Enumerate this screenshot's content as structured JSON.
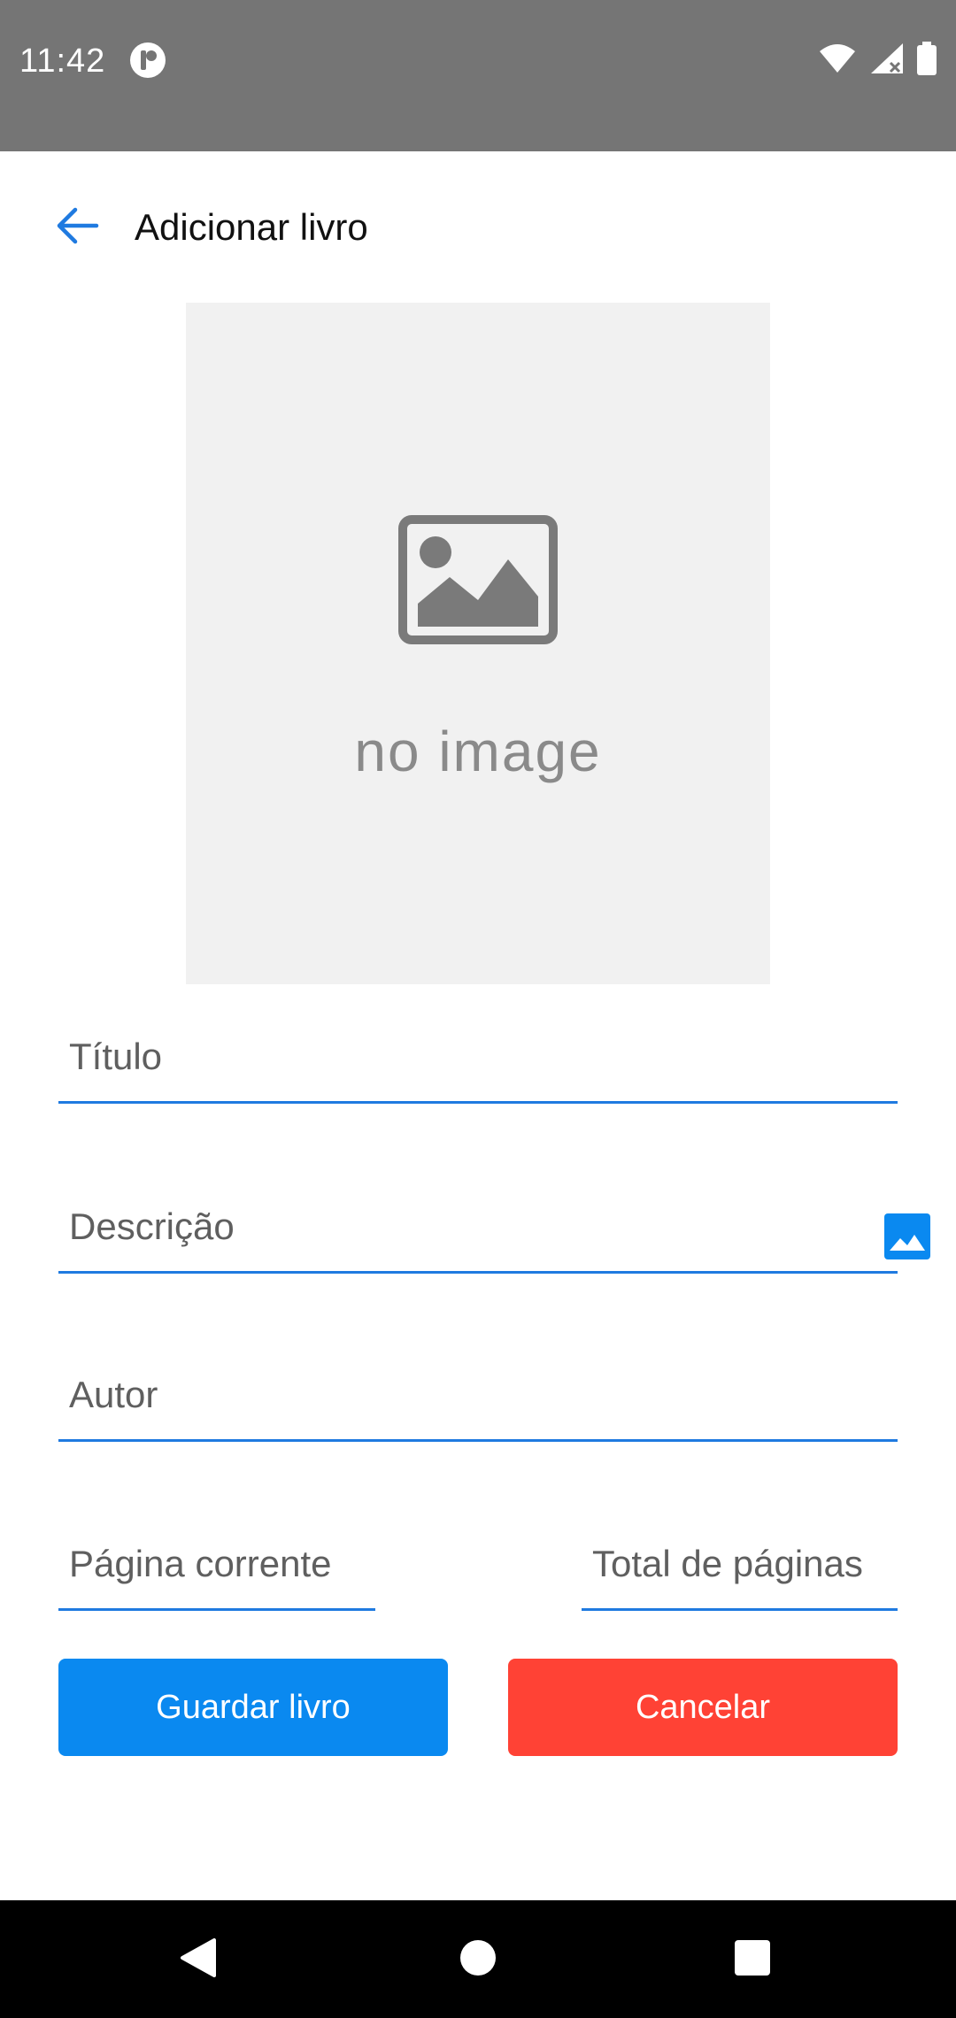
{
  "status_bar": {
    "time": "11:42",
    "icons": [
      "app-notification-icon",
      "wifi-icon",
      "signal-icon",
      "battery-icon"
    ]
  },
  "app_bar": {
    "title": "Adicionar livro",
    "back_icon": "arrow-back-icon"
  },
  "cover": {
    "placeholder_text": "no image",
    "pick_icon": "image-icon"
  },
  "form": {
    "titulo_placeholder": "Título",
    "titulo_value": "",
    "descricao_placeholder": "Descrição",
    "descricao_value": "",
    "autor_placeholder": "Autor",
    "autor_value": "",
    "pagina_corrente_placeholder": "Página corrente",
    "pagina_corrente_value": "",
    "total_paginas_placeholder": "Total de páginas",
    "total_paginas_value": ""
  },
  "buttons": {
    "save_label": "Guardar livro",
    "cancel_label": "Cancelar"
  },
  "colors": {
    "accent": "#1f7ae0",
    "save_button": "#0a89f0",
    "cancel_button": "#ff4235",
    "status_bar": "#757575"
  },
  "nav_bar": {
    "icons": [
      "nav-back-icon",
      "nav-home-icon",
      "nav-recents-icon"
    ]
  }
}
